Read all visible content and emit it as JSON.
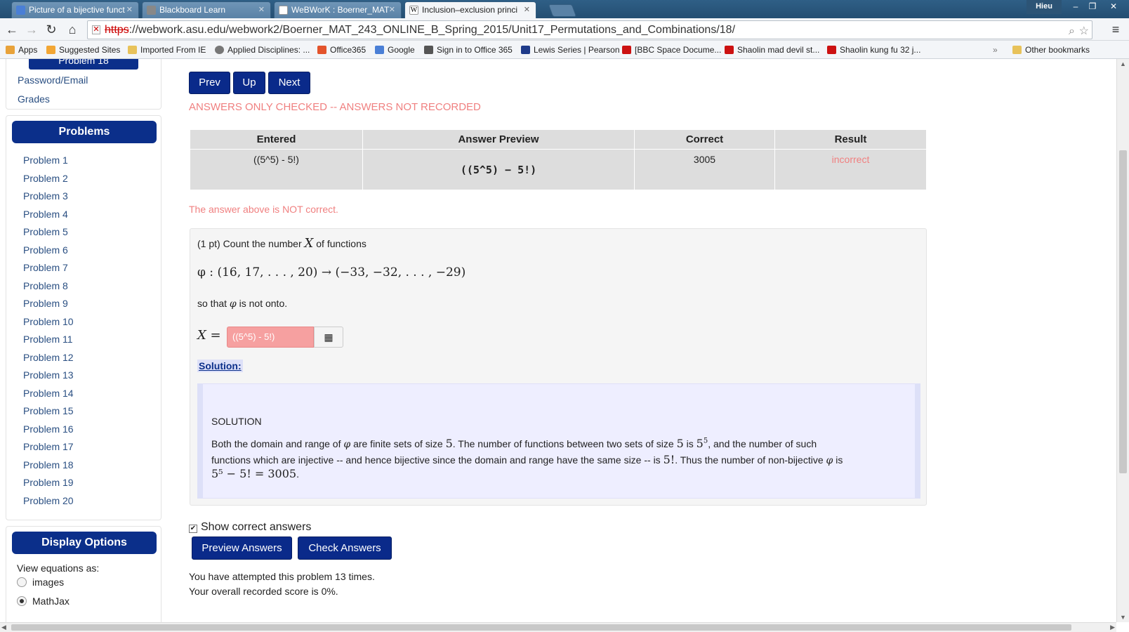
{
  "tabs": [
    {
      "label": "Picture of a bijective funct",
      "icon": "google-icon"
    },
    {
      "label": "Blackboard Learn",
      "icon": "blackboard-icon"
    },
    {
      "label": "WeBWorK : Boerner_MAT",
      "icon": "page-icon"
    },
    {
      "label": "Inclusion–exclusion princi",
      "icon": "wikipedia-icon"
    }
  ],
  "window": {
    "user": "Hieu"
  },
  "address": {
    "scheme": "https",
    "rest": "://webwork.asu.edu/webwork2/Boerner_MAT_243_ONLINE_B_Spring_2015/Unit17_Permutations_and_Combinations/18/"
  },
  "bookmarks": [
    {
      "label": "Apps",
      "color": "#e8a23a"
    },
    {
      "label": "Suggested Sites",
      "color": "#f2a634"
    },
    {
      "label": "Imported From IE",
      "color": "#e8c25a"
    },
    {
      "label": "Applied Disciplines: ...",
      "color": "#777777"
    },
    {
      "label": "Office365",
      "color": "#e3532b"
    },
    {
      "label": "Google",
      "color": "#4a7fd6"
    },
    {
      "label": "Sign in to Office 365",
      "color": "#555555"
    },
    {
      "label": "Lewis Series | Pearson",
      "color": "#1f3b8a"
    },
    {
      "label": "[BBC Space Docume...",
      "color": "#cc1111"
    },
    {
      "label": "Shaolin mad devil st...",
      "color": "#cc1111"
    },
    {
      "label": "Shaolin kung fu 32 j...",
      "color": "#cc1111"
    },
    {
      "label": "Other bookmarks",
      "color": "#e8c25a"
    }
  ],
  "sidebar": {
    "current_problem": "Problem 18",
    "links": [
      "Password/Email",
      "Grades"
    ],
    "problems_title": "Problems",
    "problems": [
      "Problem 1",
      "Problem 2",
      "Problem 3",
      "Problem 4",
      "Problem 5",
      "Problem 6",
      "Problem 7",
      "Problem 8",
      "Problem 9",
      "Problem 10",
      "Problem 11",
      "Problem 12",
      "Problem 13",
      "Problem 14",
      "Problem 15",
      "Problem 16",
      "Problem 17",
      "Problem 18",
      "Problem 19",
      "Problem 20"
    ],
    "display_title": "Display Options",
    "view_label": "View equations as:",
    "view_options": [
      "images",
      "MathJax"
    ]
  },
  "nav": {
    "prev": "Prev",
    "up": "Up",
    "next": "Next"
  },
  "status_msg": "ANSWERS ONLY CHECKED -- ANSWERS NOT RECORDED",
  "results_table": {
    "headers": [
      "Entered",
      "Answer Preview",
      "Correct",
      "Result"
    ],
    "row": {
      "entered": "((5^5) - 5!)",
      "preview": "((5^5) − 5!)",
      "correct": "3005",
      "result": "incorrect"
    }
  },
  "not_correct_msg": "The answer above is NOT correct.",
  "problem": {
    "intro_a": "(1 pt) Count the number",
    "var": "X",
    "intro_b": "of functions",
    "function_line": "φ : (16, 17, . . . , 20) → (−33, −32, . . . , −29)",
    "so_that_a": "so that",
    "phi": "φ",
    "so_that_b": "is not onto.",
    "answer_label": "X =",
    "answer_value": "((5^5) - 5!)",
    "solution_label": "Solution:",
    "solution_title": "SOLUTION",
    "sol_1a": "Both the domain and range of",
    "sol_1b": "are finite sets of size",
    "five": "5",
    "sol_1c": ". The number of functions between two sets of size",
    "sol_1d": "is",
    "sol_1e": ", and the number of such",
    "sol_2a": "functions which are injective -- and hence bijective since the domain and range have the same size -- is",
    "five_fact": "5!",
    "sol_2b": ". Thus the number of non-bijective",
    "sol_2c": "is",
    "sol_3": "5⁵ − 5! = 3005",
    "sol_3_end": "."
  },
  "show_correct": "Show correct answers",
  "actions": {
    "preview": "Preview Answers",
    "check": "Check Answers"
  },
  "footer": {
    "attempts": "You have attempted this problem 13 times.",
    "score": "Your overall recorded score is 0%."
  }
}
